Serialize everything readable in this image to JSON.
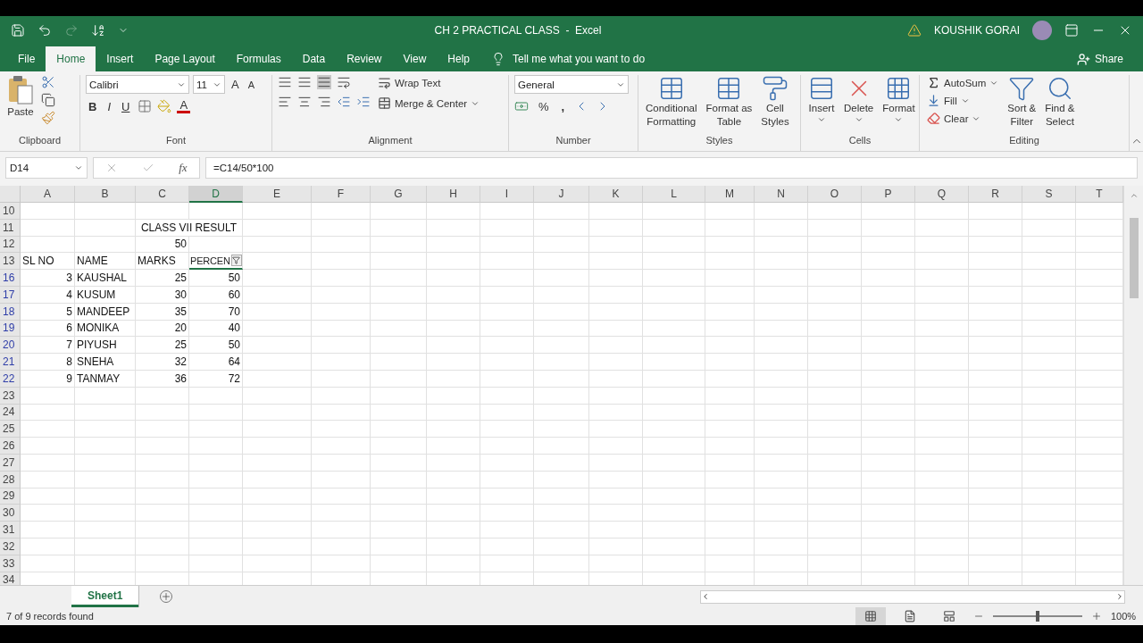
{
  "title_bar": {
    "title": "CH 2 PRACTICAL CLASS  -  Excel",
    "user": "KOUSHIK GORAI"
  },
  "menu_tabs": [
    {
      "label": "File",
      "selected": false
    },
    {
      "label": "Home",
      "selected": true
    },
    {
      "label": "Insert",
      "selected": false
    },
    {
      "label": "Page Layout",
      "selected": false
    },
    {
      "label": "Formulas",
      "selected": false
    },
    {
      "label": "Data",
      "selected": false
    },
    {
      "label": "Review",
      "selected": false
    },
    {
      "label": "View",
      "selected": false
    },
    {
      "label": "Help",
      "selected": false
    }
  ],
  "tell_me": "Tell me what you want to do",
  "share": "Share",
  "ribbon": {
    "clipboard": {
      "paste": "Paste",
      "label": "Clipboard"
    },
    "font": {
      "name": "Calibri",
      "size": "11",
      "grow": "A",
      "shrink": "A",
      "bold": "B",
      "italic": "I",
      "underline": "U",
      "font_color": "A",
      "label": "Font"
    },
    "alignment": {
      "wrap": "Wrap Text",
      "merge": "Merge & Center",
      "label": "Alignment"
    },
    "number": {
      "format": "General",
      "percent": "%",
      "comma": ",",
      "label": "Number"
    },
    "styles": {
      "buttons": [
        {
          "lines": [
            "Conditional",
            "Formatting"
          ]
        },
        {
          "lines": [
            "Format as",
            "Table"
          ]
        },
        {
          "lines": [
            "Cell",
            "Styles"
          ]
        }
      ],
      "label": "Styles"
    },
    "cells": {
      "buttons": [
        "Insert",
        "Delete",
        "Format"
      ],
      "label": "Cells"
    },
    "editing": {
      "autosum": "AutoSum",
      "fill": "Fill",
      "clear": "Clear",
      "sort": [
        "Sort &",
        "Filter"
      ],
      "find": [
        "Find &",
        "Select"
      ],
      "label": "Editing"
    }
  },
  "formula_bar": {
    "name_box": "D14",
    "fx": "fx",
    "formula": "=C14/50*100"
  },
  "grid": {
    "columns": [
      {
        "label": "A",
        "selected": false
      },
      {
        "label": "B",
        "selected": false
      },
      {
        "label": "C",
        "selected": false
      },
      {
        "label": "D",
        "selected": true
      },
      {
        "label": "E",
        "selected": false
      },
      {
        "label": "F",
        "selected": false
      },
      {
        "label": "G",
        "selected": false
      },
      {
        "label": "H",
        "selected": false
      },
      {
        "label": "I",
        "selected": false
      },
      {
        "label": "J",
        "selected": false
      },
      {
        "label": "K",
        "selected": false
      },
      {
        "label": "L",
        "selected": false
      },
      {
        "label": "M",
        "selected": false
      },
      {
        "label": "N",
        "selected": false
      },
      {
        "label": "O",
        "selected": false
      },
      {
        "label": "P",
        "selected": false
      },
      {
        "label": "Q",
        "selected": false
      },
      {
        "label": "R",
        "selected": false
      },
      {
        "label": "S",
        "selected": false
      },
      {
        "label": "T",
        "selected": false
      }
    ],
    "rows": [
      {
        "number": "10",
        "filtered": false,
        "kind": "empty"
      },
      {
        "number": "11",
        "filtered": false,
        "kind": "title",
        "text": "CLASS VII RESULT"
      },
      {
        "number": "12",
        "filtered": false,
        "kind": "max",
        "text": "50"
      },
      {
        "number": "13",
        "filtered": false,
        "kind": "header",
        "values": [
          "SL NO",
          "NAME",
          "MARKS",
          "PERCEN"
        ],
        "filter_applied": true
      },
      {
        "number": "16",
        "filtered": true,
        "kind": "record",
        "values": [
          "3",
          "KAUSHAL",
          "25",
          "50"
        ]
      },
      {
        "number": "17",
        "filtered": true,
        "kind": "record",
        "values": [
          "4",
          "KUSUM",
          "30",
          "60"
        ]
      },
      {
        "number": "18",
        "filtered": true,
        "kind": "record",
        "values": [
          "5",
          "MANDEEP",
          "35",
          "70"
        ]
      },
      {
        "number": "19",
        "filtered": true,
        "kind": "record",
        "values": [
          "6",
          "MONIKA",
          "20",
          "40"
        ]
      },
      {
        "number": "20",
        "filtered": true,
        "kind": "record",
        "values": [
          "7",
          "PIYUSH",
          "25",
          "50"
        ]
      },
      {
        "number": "21",
        "filtered": true,
        "kind": "record",
        "values": [
          "8",
          "SNEHA",
          "32",
          "64"
        ]
      },
      {
        "number": "22",
        "filtered": true,
        "kind": "record",
        "values": [
          "9",
          "TANMAY",
          "36",
          "72"
        ]
      },
      {
        "number": "23",
        "filtered": false,
        "kind": "empty"
      },
      {
        "number": "24",
        "filtered": false,
        "kind": "empty"
      },
      {
        "number": "25",
        "filtered": false,
        "kind": "empty"
      },
      {
        "number": "26",
        "filtered": false,
        "kind": "empty"
      },
      {
        "number": "27",
        "filtered": false,
        "kind": "empty"
      },
      {
        "number": "28",
        "filtered": false,
        "kind": "empty"
      },
      {
        "number": "29",
        "filtered": false,
        "kind": "empty"
      },
      {
        "number": "30",
        "filtered": false,
        "kind": "empty"
      },
      {
        "number": "31",
        "filtered": false,
        "kind": "empty"
      },
      {
        "number": "32",
        "filtered": false,
        "kind": "empty"
      },
      {
        "number": "33",
        "filtered": false,
        "kind": "empty"
      },
      {
        "number": "34",
        "filtered": false,
        "kind": "empty"
      }
    ]
  },
  "sheet_tabs": [
    {
      "label": "Sheet1",
      "selected": true
    }
  ],
  "status_bar": {
    "text": "7 of 9 records found",
    "zoom": {
      "level": 0.5,
      "reading": "100%"
    }
  }
}
